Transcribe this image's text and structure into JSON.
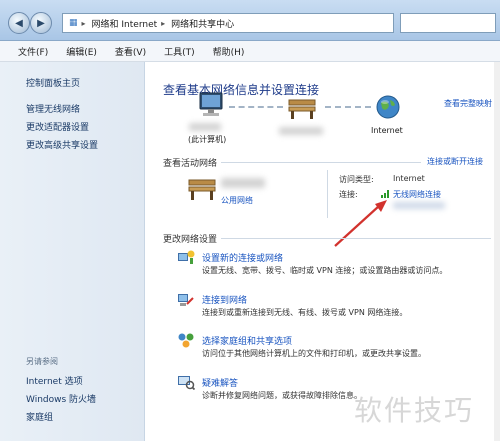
{
  "titlebar": {
    "breadcrumb": [
      "网络和 Internet",
      "网络和共享中心"
    ],
    "back_icon": "back-arrow-icon",
    "forward_icon": "forward-arrow-icon"
  },
  "menu": [
    "文件(F)",
    "编辑(E)",
    "查看(V)",
    "工具(T)",
    "帮助(H)"
  ],
  "sidebar": {
    "top_links": [
      "控制面板主页",
      "管理无线网络",
      "更改适配器设置",
      "更改高级共享设置"
    ],
    "see_also_heading": "另请参阅",
    "bottom_links": [
      "Internet 选项",
      "Windows 防火墙",
      "家庭组"
    ]
  },
  "main": {
    "title": "查看基本网络信息并设置连接",
    "full_map_link": "查看完整映射",
    "map": {
      "computer_label": "(此计算机)",
      "internet_label": "Internet"
    },
    "active_networks": {
      "heading": "查看活动网络",
      "connect_link": "连接或断开连接",
      "network_type": "公用网络",
      "access_type_label": "访问类型:",
      "access_type_value": "Internet",
      "connection_label": "连接:",
      "connection_value": "无线网络连接"
    },
    "change_settings": {
      "heading": "更改网络设置",
      "tasks": [
        {
          "title": "设置新的连接或网络",
          "desc": "设置无线、宽带、拨号、临时或 VPN 连接；或设置路由器或访问点。",
          "icon": "network-setup-icon"
        },
        {
          "title": "连接到网络",
          "desc": "连接到或重新连接到无线、有线、拨号或 VPN 网络连接。",
          "icon": "connect-network-icon"
        },
        {
          "title": "选择家庭组和共享选项",
          "desc": "访问位于其他网络计算机上的文件和打印机，或更改共享设置。",
          "icon": "homegroup-icon"
        },
        {
          "title": "疑难解答",
          "desc": "诊断并修复网络问题，或获得故障排除信息。",
          "icon": "troubleshoot-icon"
        }
      ]
    }
  },
  "watermark": "软件技巧",
  "colors": {
    "title_blue": "#1e3b8a",
    "link_blue": "#1a55c0",
    "arrow_red": "#d2322d"
  }
}
